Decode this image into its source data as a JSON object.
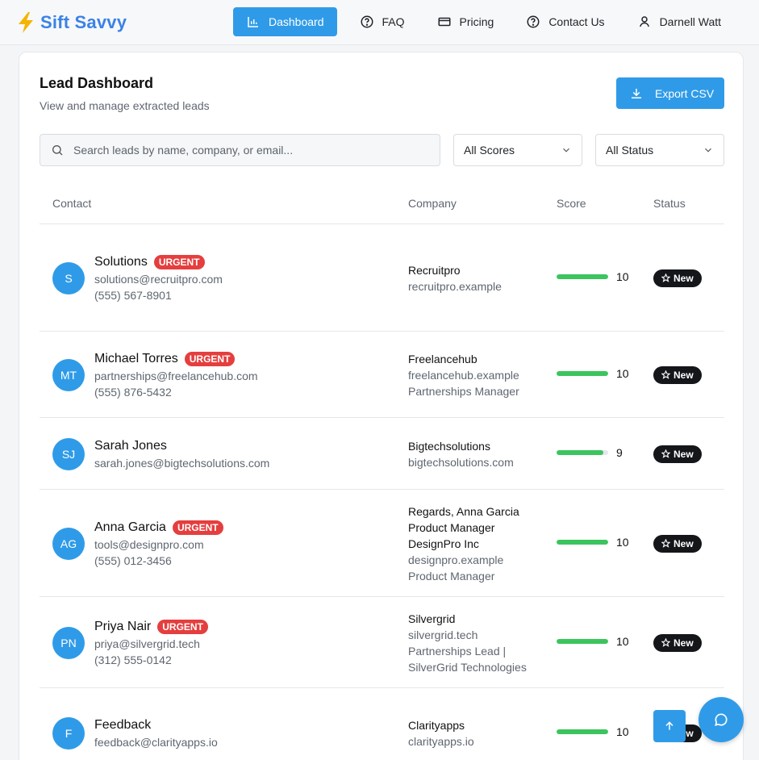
{
  "app": {
    "name": "Sift Savvy",
    "brand_color": "#2f9be8",
    "logo_icon": "lightning-bolt-icon"
  },
  "nav": {
    "dashboard": "Dashboard",
    "faq": "FAQ",
    "pricing": "Pricing",
    "contact": "Contact Us",
    "user": "Darnell Watt"
  },
  "page": {
    "title": "Lead Dashboard",
    "subtitle": "View and manage extracted leads",
    "export_label": "Export CSV"
  },
  "filters": {
    "search_placeholder": "Search leads by name, company, or email...",
    "score_selected": "All Scores",
    "status_selected": "All Status"
  },
  "table": {
    "columns": {
      "contact": "Contact",
      "company": "Company",
      "score": "Score",
      "status": "Status"
    },
    "rows": [
      {
        "initials": "S",
        "name": "Solutions",
        "urgent": "URGENT",
        "email": "solutions@recruitpro.com",
        "phone": "(555) 567-8901",
        "company": [
          "Recruitpro",
          "recruitpro.example"
        ],
        "score": "10",
        "score_fraction": 1.0,
        "status": "New"
      },
      {
        "initials": "MT",
        "name": "Michael Torres",
        "urgent": "URGENT",
        "email": "partnerships@freelancehub.com",
        "phone": "(555) 876-5432",
        "company": [
          "Freelancehub",
          "freelancehub.example",
          "Partnerships Manager"
        ],
        "score": "10",
        "score_fraction": 1.0,
        "status": "New"
      },
      {
        "initials": "SJ",
        "name": "Sarah Jones",
        "urgent": "",
        "email": "sarah.jones@bigtechsolutions.com",
        "phone": "",
        "company": [
          "Bigtechsolutions",
          "bigtechsolutions.com"
        ],
        "score": "9",
        "score_fraction": 0.9,
        "status": "New"
      },
      {
        "initials": "AG",
        "name": "Anna Garcia",
        "urgent": "URGENT",
        "email": "tools@designpro.com",
        "phone": "(555) 012-3456",
        "company": [
          "Regards, Anna Garcia",
          "Product Manager",
          "DesignPro Inc",
          "designpro.example",
          "Product Manager"
        ],
        "score": "10",
        "score_fraction": 1.0,
        "status": "New"
      },
      {
        "initials": "PN",
        "name": "Priya Nair",
        "urgent": "URGENT",
        "email": "priya@silvergrid.tech",
        "phone": "(312) 555-0142",
        "company": [
          "Silvergrid",
          "silvergrid.tech",
          "Partnerships Lead |",
          "SilverGrid Technologies"
        ],
        "score": "10",
        "score_fraction": 1.0,
        "status": "New"
      },
      {
        "initials": "F",
        "name": "Feedback",
        "urgent": "",
        "email": "feedback@clarityapps.io",
        "phone": "",
        "company": [
          "Clarityapps",
          "clarityapps.io"
        ],
        "score": "10",
        "score_fraction": 1.0,
        "status": "New"
      }
    ]
  }
}
